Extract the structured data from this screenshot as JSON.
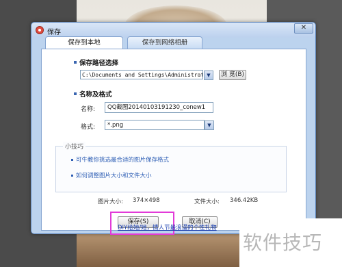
{
  "window": {
    "title": "保存",
    "close_glyph": "✕"
  },
  "tabs": [
    {
      "label": "保存到本地"
    },
    {
      "label": "保存到网络相册"
    }
  ],
  "save_path": {
    "section_title": "保存路径选择",
    "value": "C:\\Documents and Settings\\Administrator\\J",
    "browse_label": "浏 览(B)"
  },
  "name_format": {
    "section_title": "名称及格式",
    "name_label": "名称:",
    "name_value": "QQ截图20140103191230_conew1",
    "format_label": "格式:",
    "format_value": "*.png"
  },
  "tips": {
    "title": "小技巧",
    "items": [
      "可牛教你挑选最合适的图片保存格式",
      "如何调整图片大小和文件大小"
    ]
  },
  "info": {
    "image_size_label": "图片大小:",
    "image_size_value": "374×498",
    "file_size_label": "文件大小:",
    "file_size_value": "346.42KB"
  },
  "buttons": {
    "save_label": "保存(S)",
    "cancel_label": "取消(C)"
  },
  "footer_link": "DIY给她/她，情人节最浪漫的个性礼物",
  "watermark": "软件技巧",
  "colors": {
    "highlight": "#e23ad8",
    "link": "#2f5fb5",
    "dialog_bg": "#bcd3ee"
  }
}
